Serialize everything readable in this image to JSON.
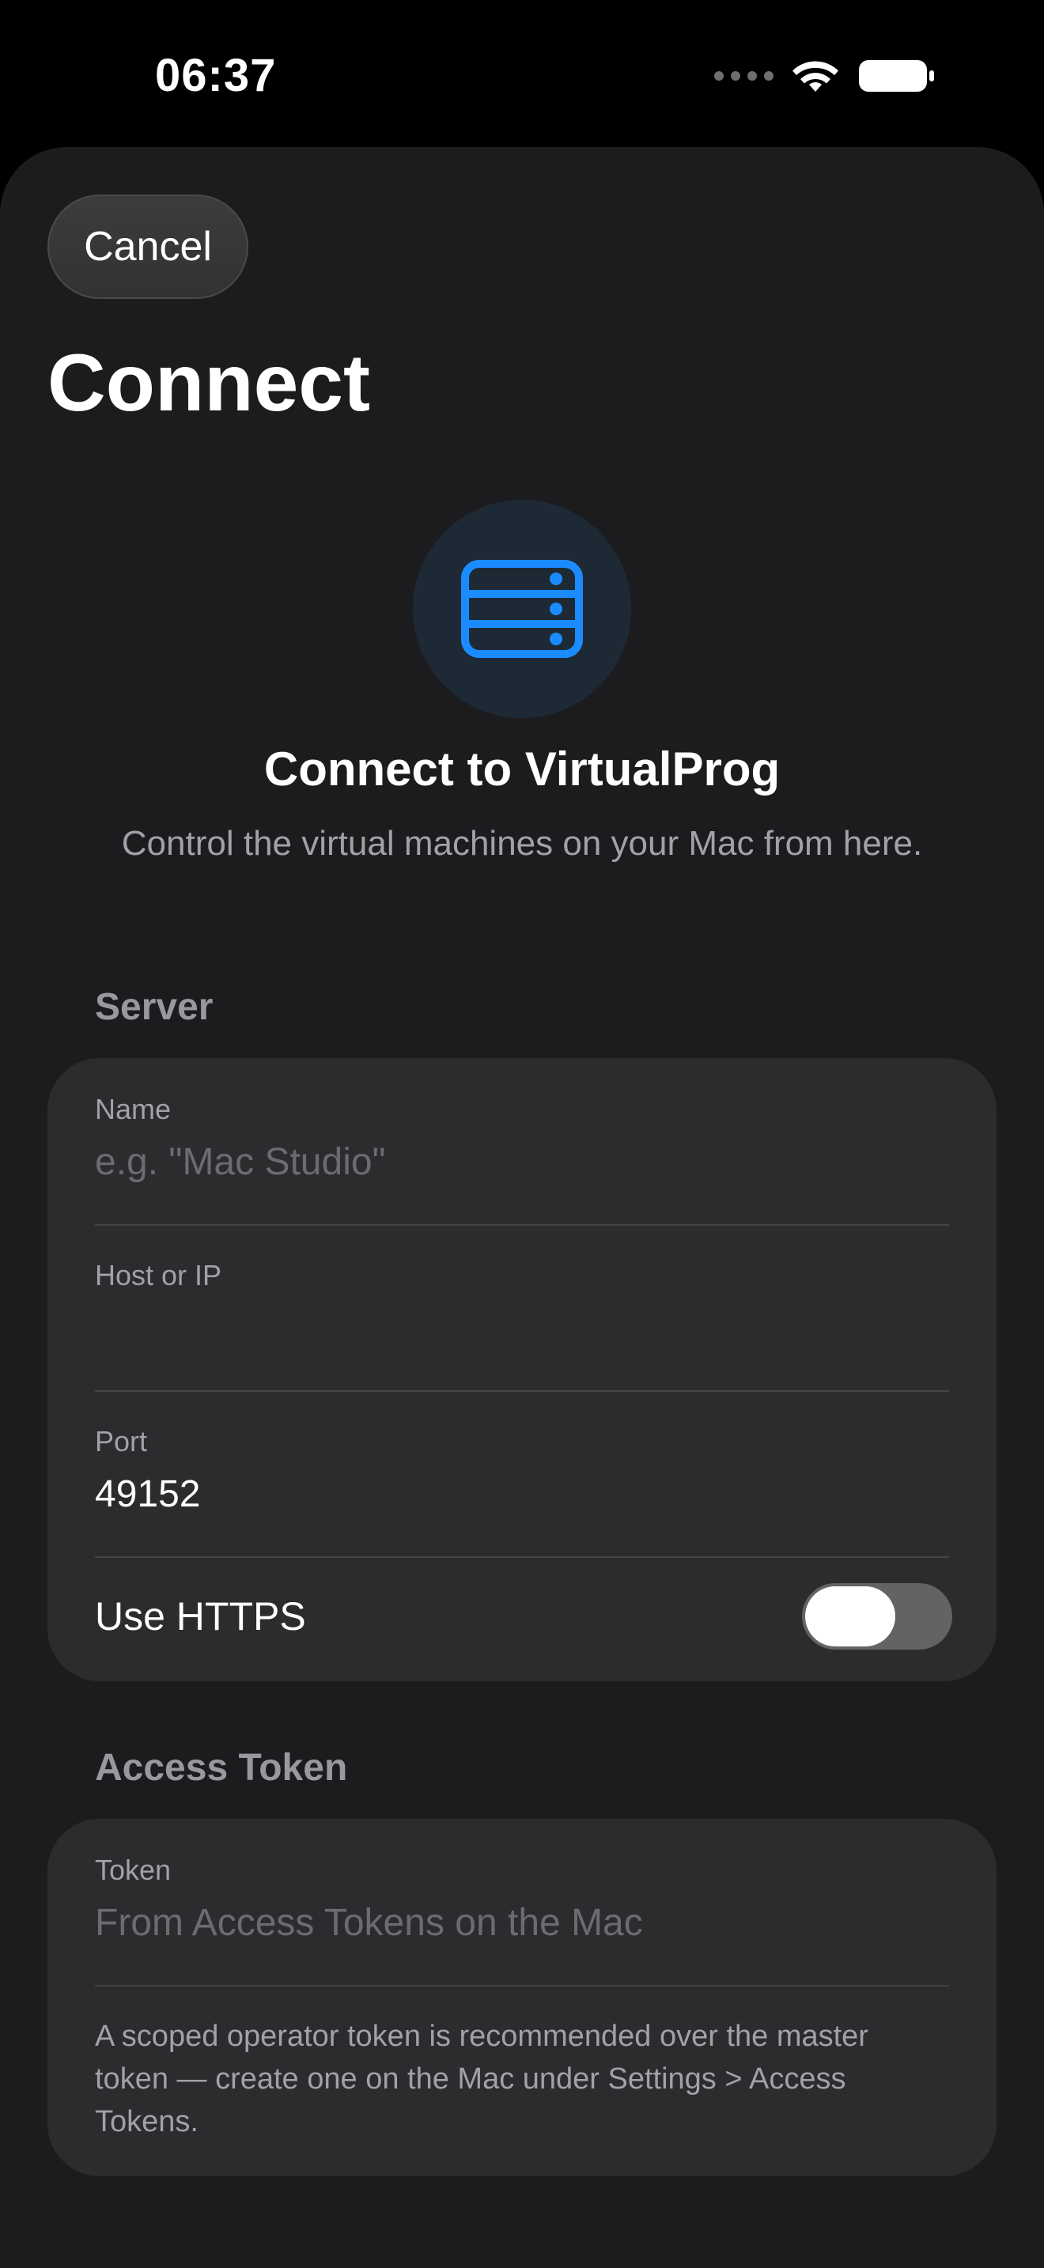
{
  "status_bar": {
    "time": "06:37"
  },
  "nav": {
    "cancel_label": "Cancel",
    "title": "Connect"
  },
  "hero": {
    "icon": "server-rack-icon",
    "title": "Connect to VirtualProg",
    "subtitle": "Control the virtual machines on your Mac from here."
  },
  "server_section": {
    "header": "Server",
    "name": {
      "label": "Name",
      "value": "",
      "placeholder": "e.g. \"Mac Studio\""
    },
    "host": {
      "label": "Host or IP",
      "value": "",
      "placeholder": ""
    },
    "port": {
      "label": "Port",
      "value": "49152"
    },
    "https": {
      "label": "Use HTTPS",
      "enabled": false
    }
  },
  "token_section": {
    "header": "Access Token",
    "token": {
      "label": "Token",
      "value": "",
      "placeholder": "From Access Tokens on the Mac"
    },
    "footnote": "A scoped operator token is recommended over the master token — create one on the Mac under Settings > Access Tokens."
  },
  "colors": {
    "accent": "#0a84ff",
    "sheet_bg": "#1c1c1e",
    "card_bg": "#2c2c2e"
  }
}
